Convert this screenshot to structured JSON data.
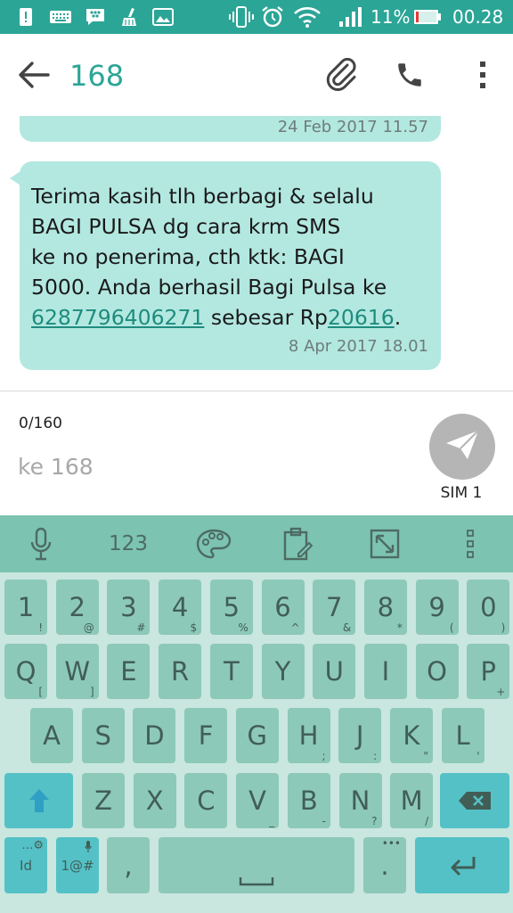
{
  "status_bar": {
    "battery_percent": "11%",
    "time": "00.28",
    "icons": [
      "alert-icon",
      "keyboard-icon",
      "blackberry-icon",
      "cleaner-icon",
      "gallery-icon",
      "vibrate-icon",
      "alarm-icon",
      "wifi-icon",
      "signal-icon",
      "battery-icon"
    ]
  },
  "app_bar": {
    "title": "168",
    "icons": [
      "back-arrow-icon",
      "attach-icon",
      "phone-icon",
      "more-vert-icon"
    ]
  },
  "messages": [
    {
      "timestamp": "24 Feb 2017 11.57"
    },
    {
      "line1": "Terima kasih tlh berbagi & selalu",
      "line2": "BAGI PULSA dg cara krm SMS",
      "line3": "ke no penerima, cth ktk: BAGI",
      "line4": "5000. Anda berhasil Bagi Pulsa ke",
      "link_number": "6287796406271",
      "text_mid": " sebesar Rp",
      "link_amount": "20616",
      "text_end": ".",
      "timestamp": "8 Apr 2017 18.01"
    }
  ],
  "compose": {
    "counter": "0/160",
    "placeholder": "ke 168",
    "value": "",
    "sim_label": "SIM 1"
  },
  "keyboard": {
    "toolbar": {
      "numbers_label": "123",
      "icons": [
        "mic-icon",
        "palette-icon",
        "clipboard-icon",
        "resize-icon",
        "more-vert-icon"
      ]
    },
    "number_row": [
      {
        "main": "1",
        "sub": "!"
      },
      {
        "main": "2",
        "sub": "@"
      },
      {
        "main": "3",
        "sub": "#"
      },
      {
        "main": "4",
        "sub": "$"
      },
      {
        "main": "5",
        "sub": "%"
      },
      {
        "main": "6",
        "sub": "^"
      },
      {
        "main": "7",
        "sub": "&"
      },
      {
        "main": "8",
        "sub": "*"
      },
      {
        "main": "9",
        "sub": "("
      },
      {
        "main": "0",
        "sub": ")"
      }
    ],
    "row1": [
      {
        "main": "Q",
        "sub": "["
      },
      {
        "main": "W",
        "sub": "]"
      },
      {
        "main": "E",
        "sub": ""
      },
      {
        "main": "R",
        "sub": ""
      },
      {
        "main": "T",
        "sub": ""
      },
      {
        "main": "Y",
        "sub": ""
      },
      {
        "main": "U",
        "sub": ""
      },
      {
        "main": "I",
        "sub": ""
      },
      {
        "main": "O",
        "sub": ""
      },
      {
        "main": "P",
        "sub": "+"
      }
    ],
    "row2": [
      {
        "main": "A",
        "sub": ""
      },
      {
        "main": "S",
        "sub": ""
      },
      {
        "main": "D",
        "sub": ""
      },
      {
        "main": "F",
        "sub": ""
      },
      {
        "main": "G",
        "sub": ""
      },
      {
        "main": "H",
        "sub": ";"
      },
      {
        "main": "J",
        "sub": ":"
      },
      {
        "main": "K",
        "sub": "\""
      },
      {
        "main": "L",
        "sub": "'"
      }
    ],
    "row3": [
      {
        "main": "Z",
        "sub": ""
      },
      {
        "main": "X",
        "sub": ""
      },
      {
        "main": "C",
        "sub": ""
      },
      {
        "main": "V",
        "sub": "_"
      },
      {
        "main": "B",
        "sub": "-"
      },
      {
        "main": "N",
        "sub": "?"
      },
      {
        "main": "M",
        "sub": "/"
      }
    ],
    "bottom": {
      "lang_label": "Id",
      "symbols_label": "1@#",
      "comma": ",",
      "period": "."
    }
  }
}
